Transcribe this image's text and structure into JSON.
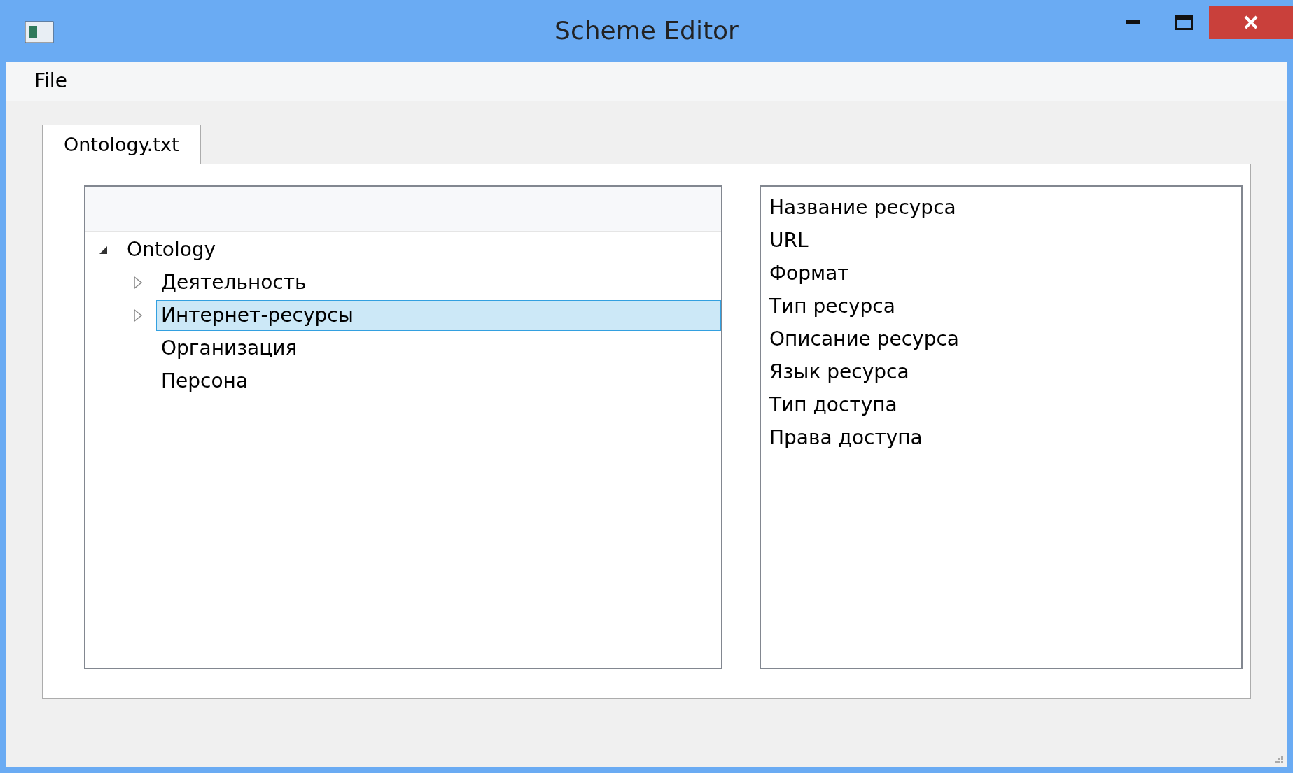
{
  "window": {
    "title": "Scheme Editor"
  },
  "menu": [
    {
      "label": "File"
    }
  ],
  "tabs": [
    {
      "label": "Ontology.txt",
      "selected": true
    }
  ],
  "tree": [
    {
      "label": "Ontology",
      "expanded": true,
      "selected": false,
      "children": [
        {
          "label": "Деятельность",
          "expanded": false,
          "selected": false
        },
        {
          "label": "Интернет-ресурсы",
          "expanded": false,
          "selected": true
        },
        {
          "label": "Организация",
          "selected": false
        },
        {
          "label": "Персона",
          "selected": false
        }
      ]
    }
  ],
  "fields": [
    {
      "label": "Название ресурса"
    },
    {
      "label": "URL"
    },
    {
      "label": "Формат"
    },
    {
      "label": "Тип ресурса"
    },
    {
      "label": "Описание ресурса"
    },
    {
      "label": "Язык ресурса"
    },
    {
      "label": "Тип доступа"
    },
    {
      "label": "Права доступа"
    }
  ]
}
